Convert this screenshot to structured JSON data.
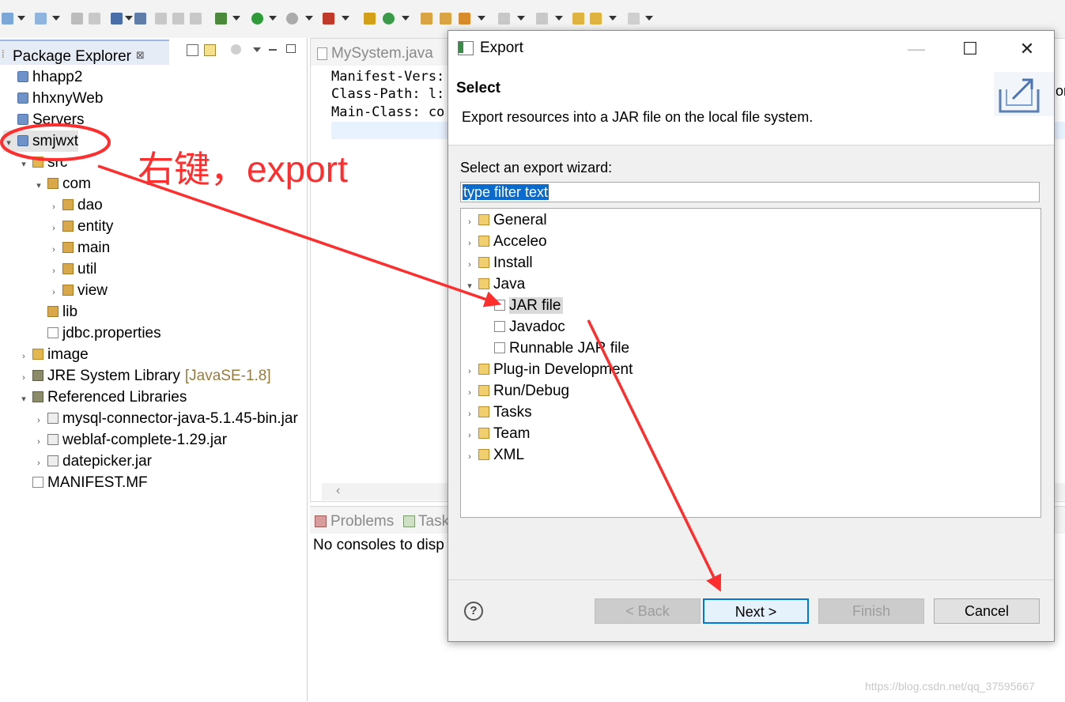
{
  "package_explorer": {
    "title": "Package Explorer",
    "close_symbol": "⊠",
    "items": [
      {
        "label": "hhapp2",
        "indent": 0,
        "icon": "project-icon",
        "twisty": ""
      },
      {
        "label": "hhxnyWeb",
        "indent": 0,
        "icon": "project-icon",
        "twisty": ""
      },
      {
        "label": "Servers",
        "indent": 0,
        "icon": "project-icon",
        "twisty": ""
      },
      {
        "label": "smjwxt",
        "indent": 0,
        "icon": "project-icon",
        "twisty": "▾"
      },
      {
        "label": "src",
        "indent": 1,
        "icon": "source-folder-icon",
        "twisty": "▾"
      },
      {
        "label": "com",
        "indent": 2,
        "icon": "package-icon",
        "twisty": "▾"
      },
      {
        "label": "dao",
        "indent": 3,
        "icon": "package-icon",
        "twisty": "›"
      },
      {
        "label": "entity",
        "indent": 3,
        "icon": "package-icon",
        "twisty": "›"
      },
      {
        "label": "main",
        "indent": 3,
        "icon": "package-icon",
        "twisty": "›"
      },
      {
        "label": "util",
        "indent": 3,
        "icon": "package-icon",
        "twisty": "›"
      },
      {
        "label": "view",
        "indent": 3,
        "icon": "package-icon",
        "twisty": "›"
      },
      {
        "label": "lib",
        "indent": 2,
        "icon": "package-icon",
        "twisty": ""
      },
      {
        "label": "jdbc.properties",
        "indent": 2,
        "icon": "file-icon",
        "twisty": ""
      },
      {
        "label": "image",
        "indent": 1,
        "icon": "source-folder-icon",
        "twisty": "›"
      },
      {
        "label": "JRE System Library",
        "indent": 1,
        "icon": "library-icon",
        "twisty": "›"
      },
      {
        "label": "Referenced Libraries",
        "indent": 1,
        "icon": "library-icon",
        "twisty": "▾"
      },
      {
        "label": "mysql-connector-java-5.1.45-bin.jar",
        "indent": 2,
        "icon": "jar-icon",
        "twisty": "›"
      },
      {
        "label": "weblaf-complete-1.29.jar",
        "indent": 2,
        "icon": "jar-icon",
        "twisty": "›"
      },
      {
        "label": "datepicker.jar",
        "indent": 2,
        "icon": "jar-icon",
        "twisty": "›"
      },
      {
        "label": "MANIFEST.MF",
        "indent": 1,
        "icon": "file-icon",
        "twisty": ""
      }
    ],
    "jre_version": "[JavaSE-1.8]"
  },
  "editor": {
    "tab_label": "MySystem.java",
    "lines": [
      "Manifest-Vers:",
      "Class-Path: l:",
      "Main-Class: co"
    ]
  },
  "console": {
    "tab_problems": "Problems",
    "tab_tasks": "Task",
    "message": "No consoles to disp"
  },
  "dialog": {
    "title": "Export",
    "heading": "Select",
    "description": "Export resources into a JAR file on the local file system.",
    "wizard_label": "Select an export wizard:",
    "filter_placeholder": "type filter text",
    "banner_side_text": "or",
    "tree": [
      {
        "label": "General",
        "level": 0,
        "twisty": "›",
        "icon": "folder-icon"
      },
      {
        "label": "Acceleo",
        "level": 0,
        "twisty": "›",
        "icon": "folder-icon"
      },
      {
        "label": "Install",
        "level": 0,
        "twisty": "›",
        "icon": "folder-icon"
      },
      {
        "label": "Java",
        "level": 0,
        "twisty": "▾",
        "icon": "folder-icon"
      },
      {
        "label": "JAR file",
        "level": 1,
        "twisty": "",
        "icon": "jar-file-icon",
        "selected": true
      },
      {
        "label": "Javadoc",
        "level": 1,
        "twisty": "",
        "icon": "javadoc-icon"
      },
      {
        "label": "Runnable JAR file",
        "level": 1,
        "twisty": "",
        "icon": "runnable-jar-icon"
      },
      {
        "label": "Plug-in Development",
        "level": 0,
        "twisty": "›",
        "icon": "folder-icon"
      },
      {
        "label": "Run/Debug",
        "level": 0,
        "twisty": "›",
        "icon": "folder-icon"
      },
      {
        "label": "Tasks",
        "level": 0,
        "twisty": "›",
        "icon": "folder-icon"
      },
      {
        "label": "Team",
        "level": 0,
        "twisty": "›",
        "icon": "folder-icon"
      },
      {
        "label": "XML",
        "level": 0,
        "twisty": "›",
        "icon": "folder-icon"
      }
    ],
    "buttons": {
      "back": "< Back",
      "next": "Next >",
      "finish": "Finish",
      "cancel": "Cancel"
    },
    "help_symbol": "?",
    "minimize_symbol": "—",
    "maximize_symbol": "☐",
    "close_symbol": "✕"
  },
  "annotation": {
    "text": "右键，export",
    "color": "#ff2e2e"
  },
  "watermark": "https://blog.csdn.net/qq_37595667"
}
